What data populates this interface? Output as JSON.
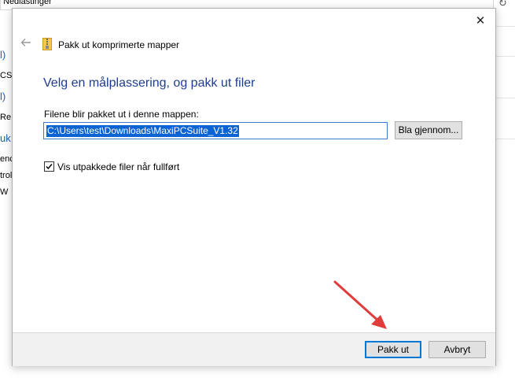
{
  "background": {
    "address_text": "Nedlastinger",
    "refresh_icon": "refresh-icon",
    "fragments": [
      "l)",
      "CS",
      "l)",
      "Re",
      "uk",
      "enc",
      "trol",
      "W"
    ]
  },
  "dialog": {
    "title": "Pakk ut komprimerte mapper",
    "back_icon": "back-arrow-icon",
    "close_icon": "close-icon",
    "heading": "Velg en målplassering, og pakk ut filer",
    "path_label": "Filene blir pakket ut i denne mappen:",
    "path_value": "C:\\Users\\test\\Downloads\\MaxiPCSuite_V1.32",
    "browse_label": "Bla gjennom...",
    "checkbox_label": "Vis utpakkede filer når fullført",
    "checkbox_checked": true,
    "extract_label": "Pakk ut",
    "cancel_label": "Avbryt"
  },
  "colors": {
    "heading": "#1e3d8f",
    "selection": "#0b63d4",
    "primary_border": "#0078d7",
    "annotation_arrow": "#e03c3c"
  }
}
